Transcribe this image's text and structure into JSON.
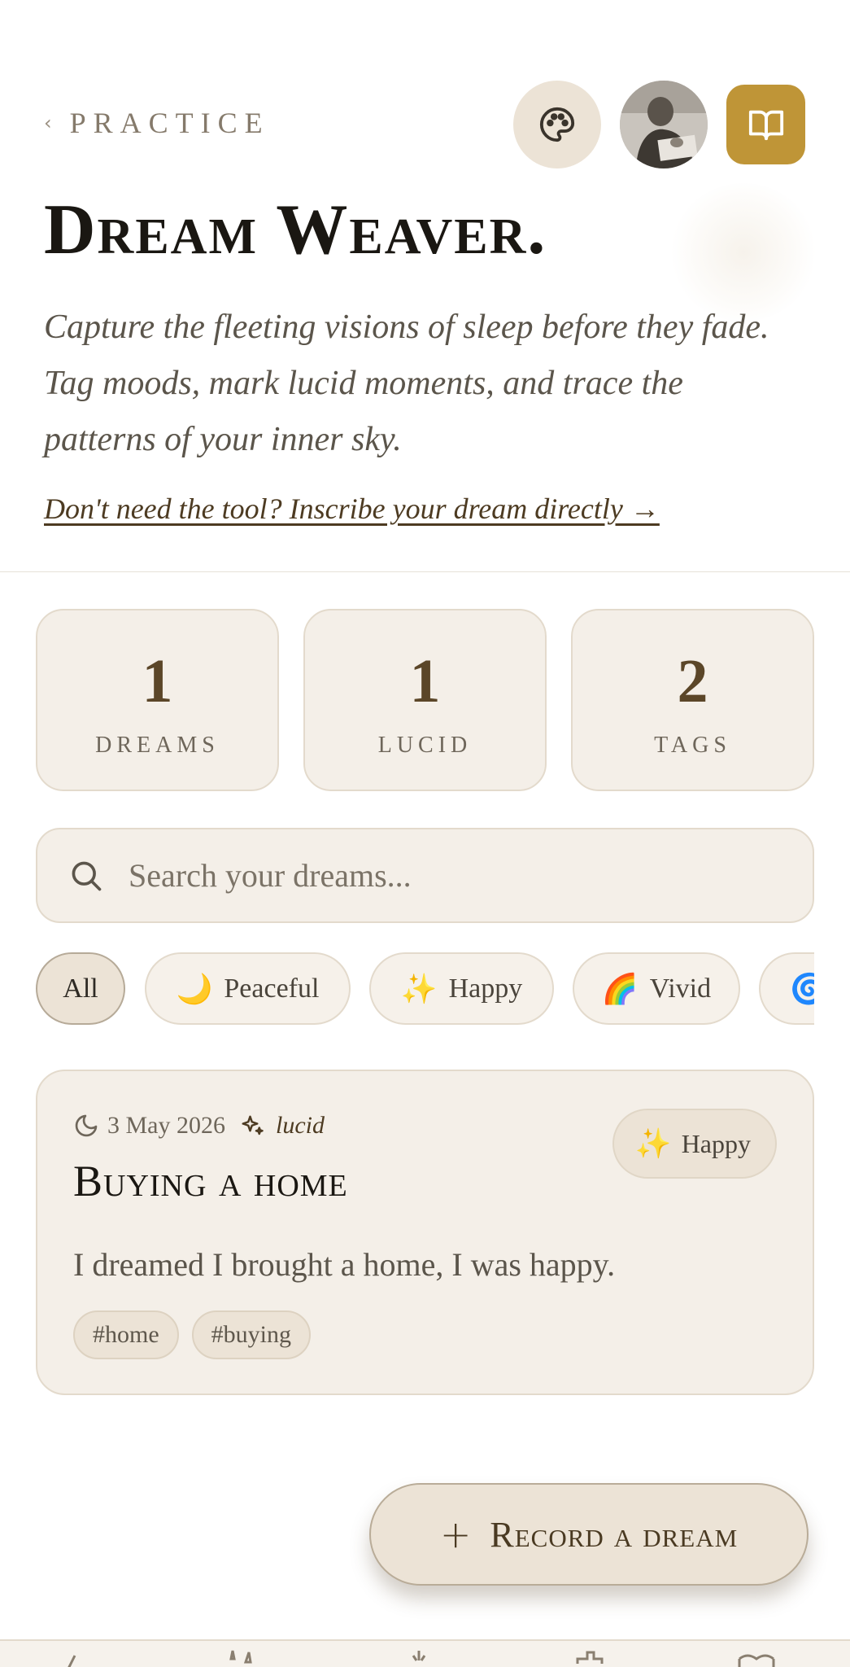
{
  "header": {
    "back_label": "PRACTICE",
    "title": "Dream Weaver.",
    "subtitle": "Capture the fleeting visions of sleep before they fade. Tag moods, mark lucid moments, and trace the patterns of your inner sky.",
    "direct_link": "Don't need the tool? Inscribe your dream directly →",
    "icons": [
      "chevron-left-icon",
      "palette-icon",
      "avatar",
      "book-open-icon"
    ],
    "accent_color": "#bf9537"
  },
  "stats": [
    {
      "value": "1",
      "label": "DREAMS"
    },
    {
      "value": "1",
      "label": "LUCID"
    },
    {
      "value": "2",
      "label": "TAGS"
    }
  ],
  "search": {
    "placeholder": "Search your dreams..."
  },
  "filters": [
    {
      "label": "All",
      "emoji": "",
      "active": true
    },
    {
      "label": "Peaceful",
      "emoji": "🌙"
    },
    {
      "label": "Happy",
      "emoji": "✨"
    },
    {
      "label": "Vivid",
      "emoji": "🌈"
    },
    {
      "label": "",
      "emoji": "🌀"
    }
  ],
  "entries": [
    {
      "date": "3 May 2026",
      "lucid_label": "lucid",
      "mood": {
        "label": "Happy",
        "emoji": "✨"
      },
      "title": "Buying a home",
      "body": "I dreamed I brought a home, I was happy.",
      "tags": [
        "#home",
        "#buying"
      ]
    }
  ],
  "record_button": {
    "label": "Record a dream",
    "icon": "plus-icon"
  }
}
